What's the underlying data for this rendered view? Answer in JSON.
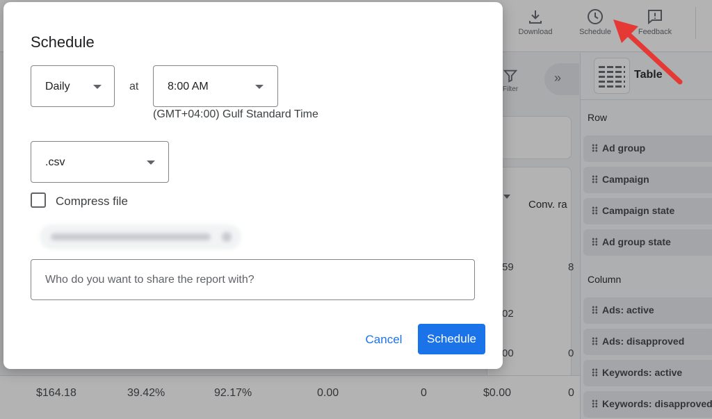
{
  "toolbar": {
    "download_label": "Download",
    "schedule_label": "Schedule",
    "feedback_label": "Feedback"
  },
  "report": {
    "filter_label": "Filter",
    "conv_rate_header": "Conv. ra",
    "side_values": [
      "59",
      "8",
      "02",
      "00",
      "0"
    ],
    "summary_row": [
      "$164.18",
      "39.42%",
      "92.17%",
      "0.00",
      "0",
      "$0.00",
      "0"
    ]
  },
  "right_panel": {
    "view_label": "Table",
    "row_section": "Row",
    "row_items": [
      "Ad group",
      "Campaign",
      "Campaign state",
      "Ad group state"
    ],
    "column_section": "Column",
    "column_items": [
      "Ads: active",
      "Ads: disapproved",
      "Keywords: active",
      "Keywords: disapproved"
    ]
  },
  "dialog": {
    "title": "Schedule",
    "frequency": "Daily",
    "at_label": "at",
    "time": "8:00 AM",
    "timezone": "(GMT+04:00) Gulf Standard Time",
    "format": ".csv",
    "compress_label": "Compress file",
    "compress_checked": false,
    "share_placeholder": "Who do you want to share the report with?",
    "share_value": "",
    "cancel_label": "Cancel",
    "schedule_label": "Schedule"
  },
  "colors": {
    "primary": "#1a73e8",
    "annotation_arrow": "#e53935"
  },
  "icons": [
    "download-icon",
    "clock-icon",
    "feedback-icon",
    "filter-icon",
    "collapse-panel-icon",
    "table-view-icon",
    "drag-handle-icon",
    "dropdown-caret-icon"
  ]
}
